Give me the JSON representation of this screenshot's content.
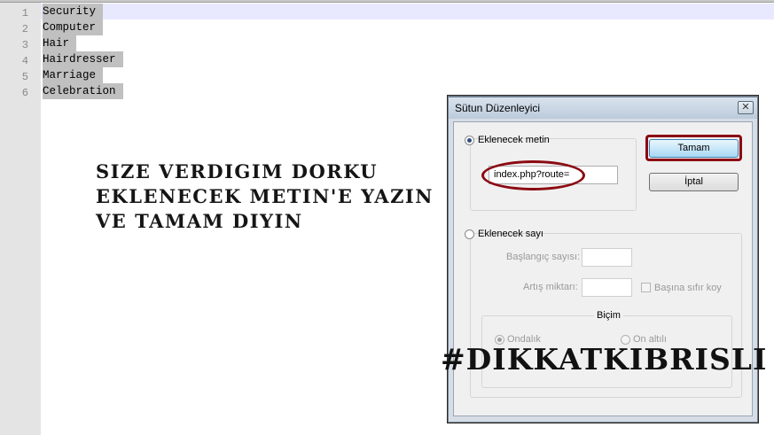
{
  "editor": {
    "line_numbers": [
      "1",
      "2",
      "3",
      "4",
      "5",
      "6"
    ],
    "lines": [
      "Security",
      "Computer",
      "Hair",
      "Hairdresser",
      "Marriage",
      "Celebration"
    ]
  },
  "annotation": {
    "lines": [
      "Size verdigim dorku",
      "eklenecek metin'e yazin",
      "ve tamam diyin"
    ],
    "hashtag": "#DIKKATKIBRISLI"
  },
  "dialog": {
    "title": "Sütun Düzenleyici",
    "close_glyph": "✕",
    "text_option_label": "Eklenecek metin",
    "text_value": "index.php?route=",
    "ok_label": "Tamam",
    "cancel_label": "İptal",
    "number_option_label": "Eklenecek sayı",
    "start_label": "Başlangıç sayısı:",
    "increment_label": "Artış miktarı:",
    "leading_zero_label": "Başına sıfır koy",
    "format_legend": "Biçim",
    "decimal_label": "Ondalık",
    "hex_label": "On altılı"
  },
  "colors": {
    "highlight_red": "#8b0a12",
    "selection_gray": "#c0c0c0",
    "current_line": "#e8e8ff"
  }
}
